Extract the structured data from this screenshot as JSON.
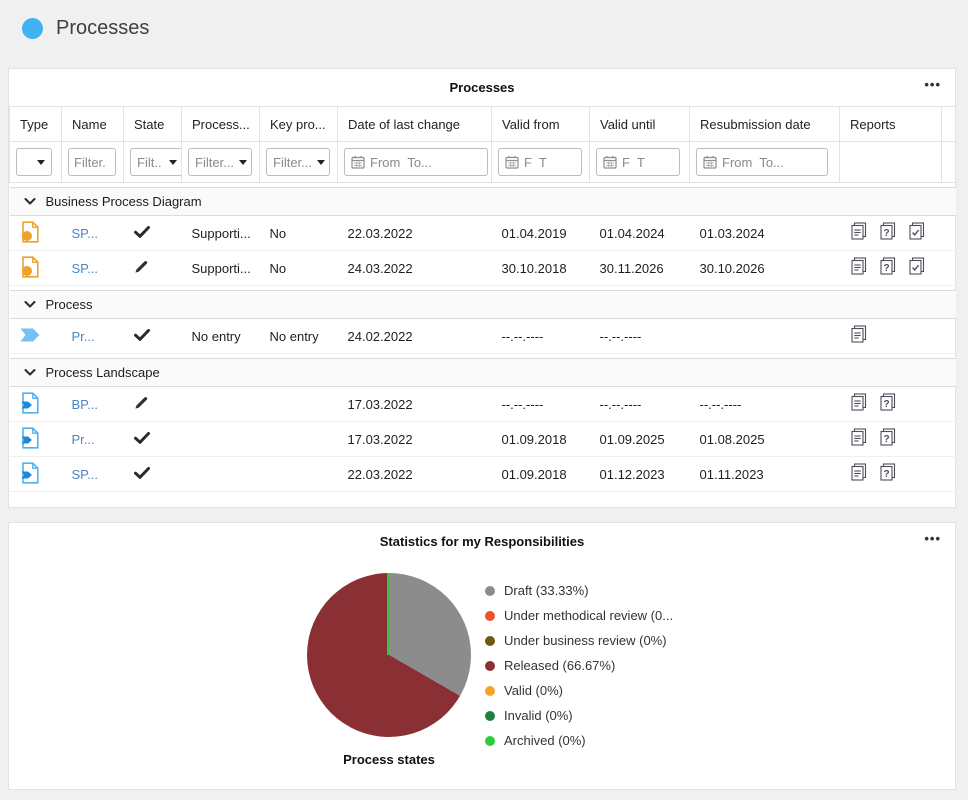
{
  "page": {
    "title": "Processes"
  },
  "processes_panel": {
    "title": "Processes",
    "menu": "•••",
    "columns": {
      "type": "Type",
      "name": "Name",
      "state": "State",
      "process": "Process...",
      "key_process": "Key pro...",
      "last_change": "Date of last change",
      "valid_from": "Valid from",
      "valid_until": "Valid until",
      "resubmission": "Resubmission date",
      "reports": "Reports"
    },
    "filters": {
      "name_placeholder": "Filter.",
      "state_label": "Filt..",
      "process_label": "Filter...",
      "key_label": "Filter...",
      "date_change_label": "From  To...",
      "valid_from_label": "F  T",
      "valid_until_label": "F  T",
      "resubmission_label": "From  To..."
    },
    "groups": [
      {
        "label": "Business Process Diagram",
        "rows": [
          {
            "name": "SP...",
            "state": "approved",
            "process": "Supporti...",
            "key_process": "No",
            "last_change": "22.03.2022",
            "valid_from": "01.04.2019",
            "valid_until": "01.04.2024",
            "resubmission": "01.03.2024",
            "reports": [
              "report-document-icon",
              "report-question-icon",
              "report-check-icon"
            ]
          },
          {
            "name": "SP...",
            "state": "in-progress",
            "process": "Supporti...",
            "key_process": "No",
            "last_change": "24.03.2022",
            "valid_from": "30.10.2018",
            "valid_until": "30.11.2026",
            "resubmission": "30.10.2026",
            "reports": [
              "report-document-icon",
              "report-question-icon",
              "report-check-icon"
            ]
          }
        ]
      },
      {
        "label": "Process",
        "rows": [
          {
            "name": "Pr...",
            "state": "approved",
            "process": "No entry",
            "key_process": "No entry",
            "last_change": "24.02.2022",
            "valid_from": "--.--.----",
            "valid_until": "--.--.----",
            "resubmission": "",
            "reports": [
              "report-document-icon"
            ]
          }
        ]
      },
      {
        "label": "Process Landscape",
        "rows": [
          {
            "name": "BP...",
            "state": "in-progress",
            "process": "",
            "key_process": "",
            "last_change": "17.03.2022",
            "valid_from": "--.--.----",
            "valid_until": "--.--.----",
            "resubmission": "--.--.----",
            "reports": [
              "report-document-icon",
              "report-question-icon"
            ]
          },
          {
            "name": "Pr...",
            "state": "approved",
            "process": "",
            "key_process": "",
            "last_change": "17.03.2022",
            "valid_from": "01.09.2018",
            "valid_until": "01.09.2025",
            "resubmission": "01.08.2025",
            "reports": [
              "report-document-icon",
              "report-question-icon"
            ]
          },
          {
            "name": "SP...",
            "state": "approved",
            "process": "",
            "key_process": "",
            "last_change": "22.03.2022",
            "valid_from": "01.09.2018",
            "valid_until": "01.12.2023",
            "resubmission": "01.11.2023",
            "reports": [
              "report-document-icon",
              "report-question-icon"
            ]
          }
        ]
      }
    ]
  },
  "statistics_panel": {
    "title": "Statistics for my Responsibilities",
    "menu": "•••",
    "chart_label": "Process states"
  },
  "chart_data": {
    "type": "pie",
    "title": "Process states",
    "labels": [
      "Draft",
      "Under methodical review",
      "Under business review",
      "Released",
      "Valid",
      "Invalid",
      "Archived"
    ],
    "values": [
      33.33,
      0,
      0,
      66.67,
      0,
      0,
      0
    ],
    "colors": [
      "#8c8c8c",
      "#f1502f",
      "#6f5a10",
      "#8a2f33",
      "#f2a42d",
      "#20803c",
      "#2fcb3d"
    ],
    "legend_labels": [
      "Draft (33.33%)",
      "Under methodical review (0...",
      "Under business review (0%)",
      "Released (66.67%)",
      "Valid (0%)",
      "Invalid (0%)",
      "Archived (0%)"
    ],
    "legend_position": "right",
    "start_angle_deg": 0,
    "direction": "clockwise"
  }
}
